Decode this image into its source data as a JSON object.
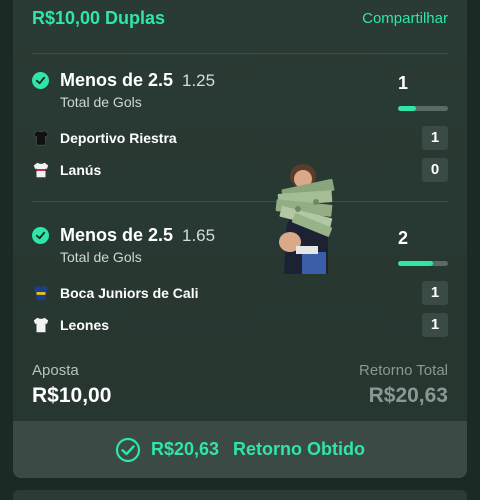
{
  "bet": {
    "title": "R$10,00 Duplas",
    "share_label": "Compartilhar"
  },
  "selections": [
    {
      "market": "Menos de 2.5",
      "odd": "1.25",
      "market_type": "Total de Gols",
      "goal_count": "1",
      "goal_progress": 0.35,
      "teams": [
        {
          "name": "Deportivo Riestra",
          "score": "1",
          "jersey_icon": "black-jersey-icon"
        },
        {
          "name": "Lanús",
          "score": "0",
          "jersey_icon": "white-red-jersey-icon"
        }
      ]
    },
    {
      "market": "Menos de 2.5",
      "odd": "1.65",
      "market_type": "Total de Gols",
      "goal_count": "2",
      "goal_progress": 0.7,
      "teams": [
        {
          "name": "Boca Juniors de Cali",
          "score": "1",
          "jersey_icon": "blue-yellow-jersey-icon"
        },
        {
          "name": "Leones",
          "score": "1",
          "jersey_icon": "white-jersey-icon"
        }
      ]
    }
  ],
  "summary": {
    "stake_label": "Aposta",
    "stake_value": "R$10,00",
    "return_label": "Retorno Total",
    "return_value": "R$20,63"
  },
  "cashout": {
    "amount": "R$20,63",
    "label": "Retorno Obtido"
  },
  "colors": {
    "accent": "#2ee6a6",
    "card_bg": "#2a3a34",
    "muted": "#8a9893"
  }
}
